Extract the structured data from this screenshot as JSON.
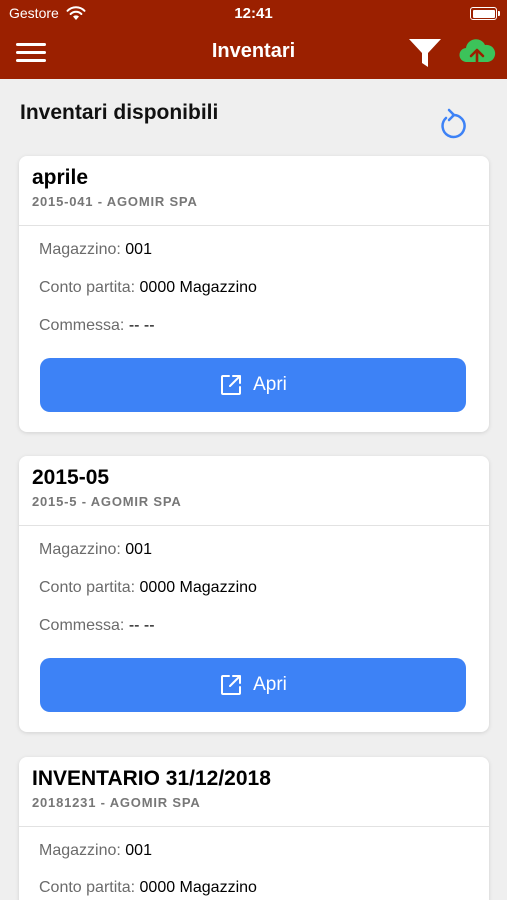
{
  "status_bar": {
    "carrier": "Gestore",
    "time": "12:41"
  },
  "nav": {
    "title": "Inventari"
  },
  "header": {
    "title": "Inventari disponibili"
  },
  "labels": {
    "magazzino": "Magazzino:",
    "conto": "Conto partita:",
    "commessa": "Commessa:",
    "open_button": "Apri"
  },
  "cards": [
    {
      "name": "aprile",
      "subtitle": "2015-041 - AGOMIR SPA",
      "magazzino": "001",
      "conto": "0000 Magazzino",
      "commessa": "-- --"
    },
    {
      "name": "2015-05",
      "subtitle": "2015-5 - AGOMIR SPA",
      "magazzino": "001",
      "conto": "0000 Magazzino",
      "commessa": "-- --"
    },
    {
      "name": "INVENTARIO 31/12/2018",
      "subtitle": "20181231 - AGOMIR SPA",
      "magazzino": "001",
      "conto": "0000 Magazzino",
      "commessa": "-- --"
    }
  ],
  "colors": {
    "nav_bar": "#9b2000",
    "button": "#3d82f6",
    "upload_icon": "#3cc35a",
    "refresh_icon": "#3d82f6"
  }
}
